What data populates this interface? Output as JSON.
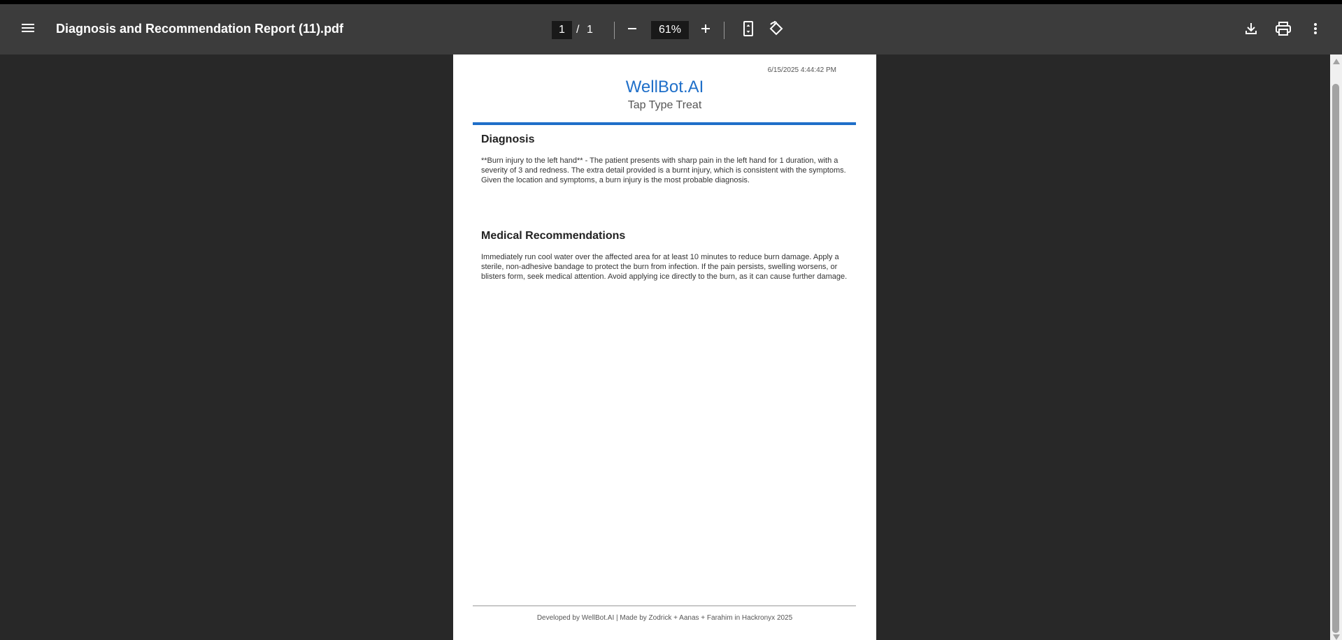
{
  "toolbar": {
    "title": "Diagnosis and Recommendation Report (11).pdf",
    "current_page": "1",
    "page_separator": "/",
    "total_pages": "1",
    "zoom": "61%",
    "icons": [
      "menu-icon",
      "zoom-out-icon",
      "zoom-in-icon",
      "fit-page-icon",
      "rotate-icon",
      "download-icon",
      "print-icon",
      "more-options-icon"
    ]
  },
  "document": {
    "timestamp": "6/15/2025 4:44:42 PM",
    "brand": "WellBot.AI",
    "tagline": "Tap Type Treat",
    "brand_color": "#1f6fc9",
    "sections": [
      {
        "title": "Diagnosis",
        "body": "**Burn injury to the left hand** - The patient presents with sharp pain in the left hand for 1 duration, with a severity of 3 and redness. The extra detail provided is a burnt injury, which is consistent with the symptoms. Given the location and symptoms, a burn injury is the most probable diagnosis."
      },
      {
        "title": "Medical Recommendations",
        "body": "Immediately run cool water over the affected area for at least 10 minutes to reduce burn damage. Apply a sterile, non-adhesive bandage to protect the burn from infection. If the pain persists, swelling worsens, or blisters form, seek medical attention. Avoid applying ice directly to the burn, as it can cause further damage."
      }
    ],
    "footer": "Developed by WellBot.AI | Made by Zodrick + Aanas + Farahim in Hackronyx 2025"
  }
}
